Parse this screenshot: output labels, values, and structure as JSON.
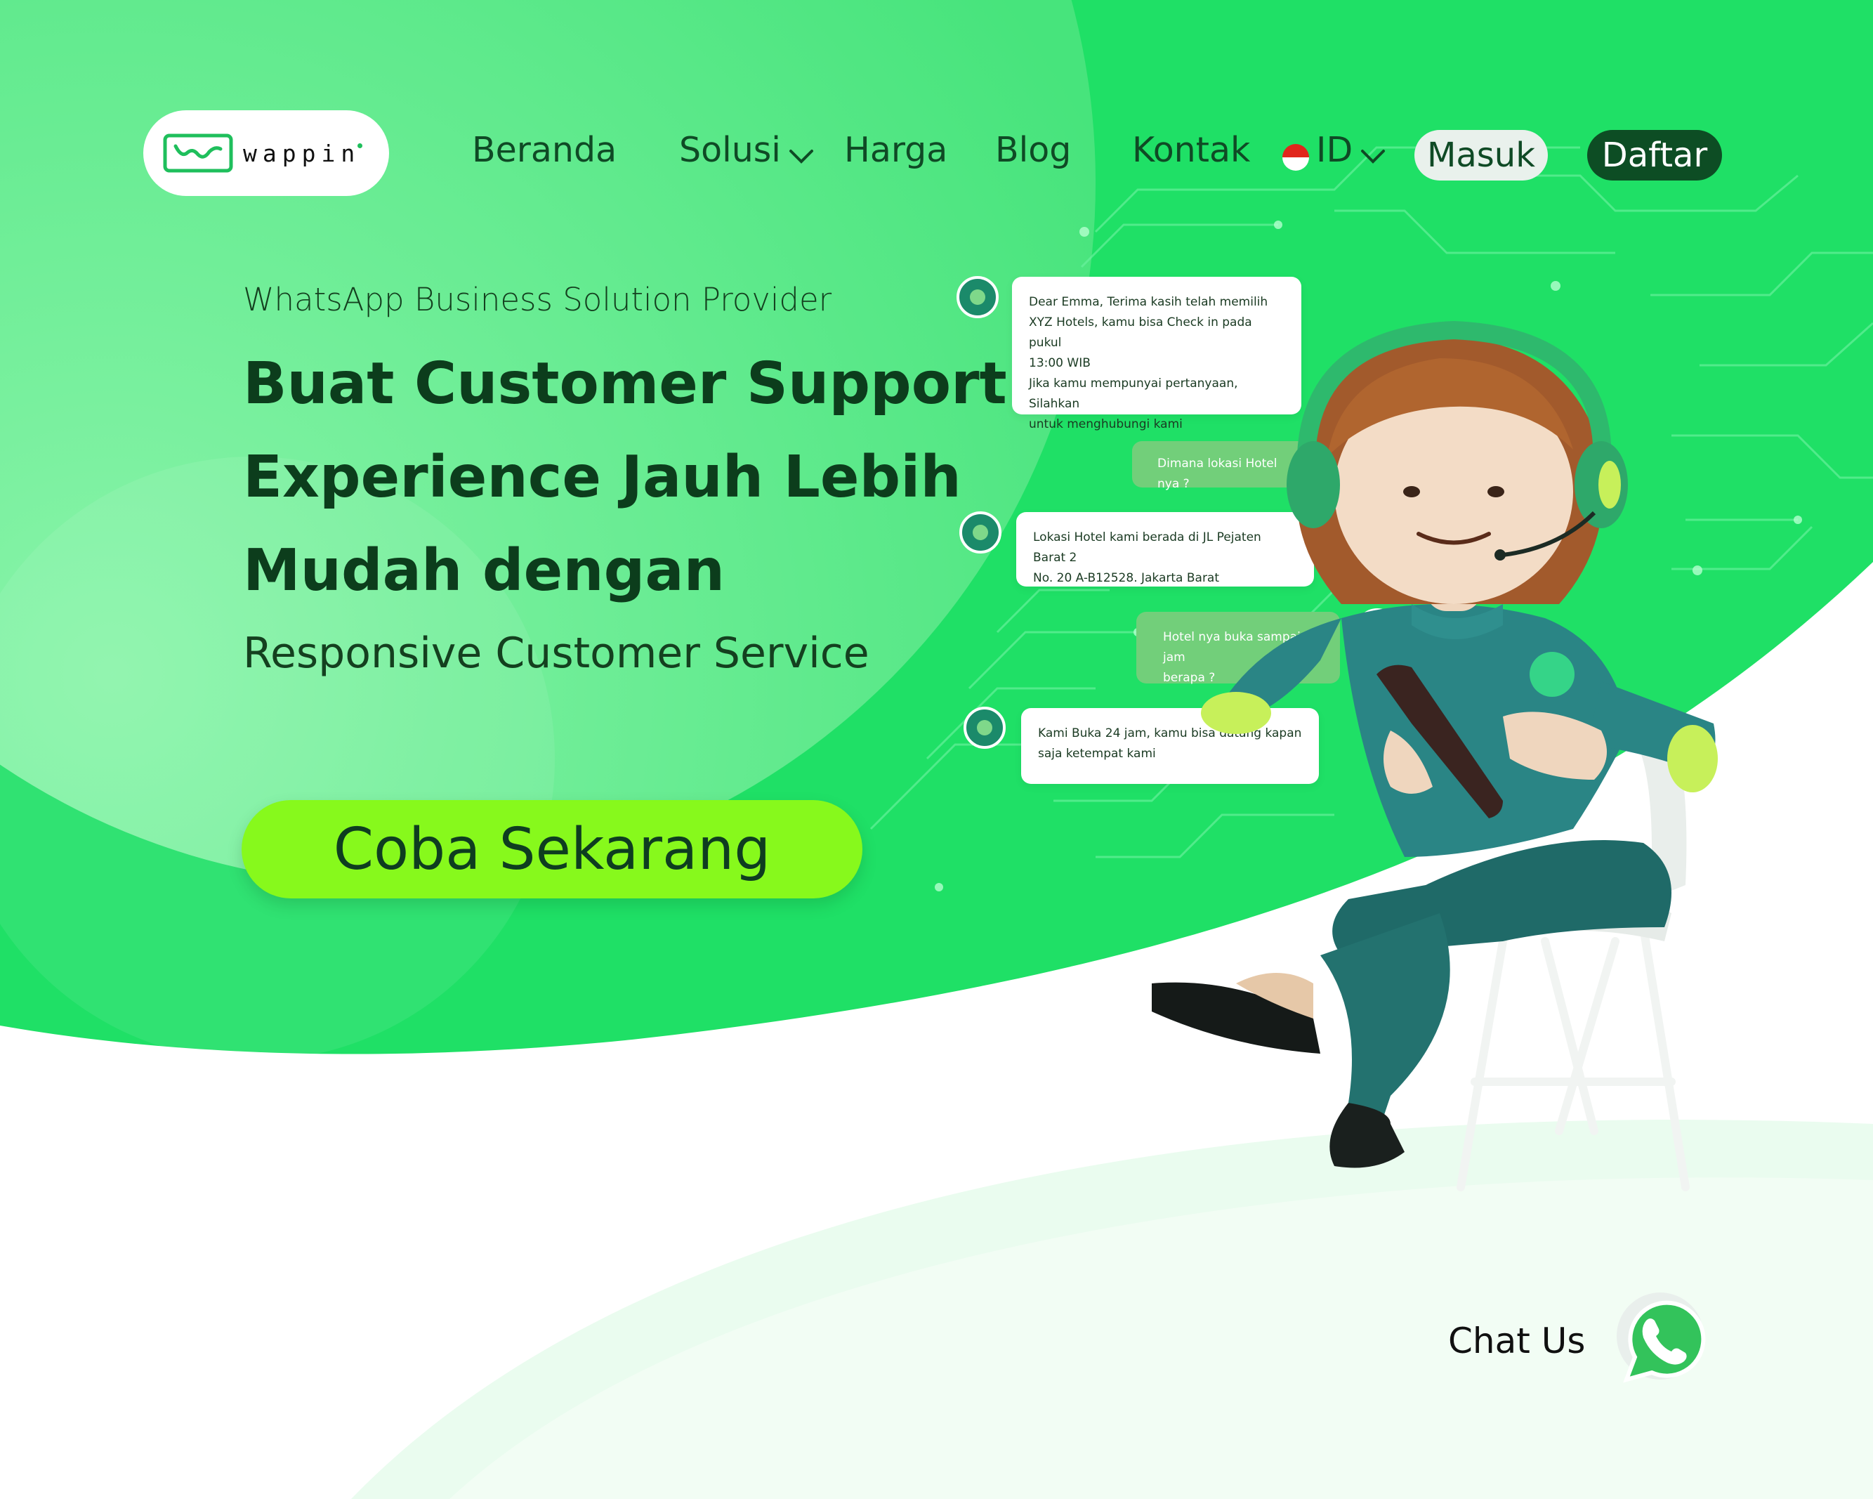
{
  "brand": {
    "name": "wappin",
    "logo_icon": "wappin-logo-icon"
  },
  "nav": {
    "items": [
      {
        "label": "Beranda"
      },
      {
        "label": "Solusi",
        "icon": "chevron-down-icon"
      },
      {
        "label": "Harga"
      },
      {
        "label": "Blog"
      },
      {
        "label": "Kontak"
      }
    ],
    "language": {
      "label": "ID",
      "flag": "indonesia-flag-icon",
      "icon": "chevron-down-icon"
    },
    "login_label": "Masuk",
    "register_label": "Daftar"
  },
  "hero": {
    "eyebrow": "WhatsApp Business Solution Provider",
    "headline_lines": [
      "Buat Customer Support",
      "Experience Jauh Lebih",
      "Mudah dengan"
    ],
    "subline": "Responsive Customer Service",
    "cta_label": "Coba Sekarang"
  },
  "chat": {
    "messages": [
      {
        "from": "bot",
        "lines": [
          "Dear Emma, Terima kasih telah memilih",
          "XYZ Hotels, kamu bisa Check in pada pukul",
          "13:00 WIB",
          "Jika kamu mempunyai pertanyaan, Silahkan",
          "untuk menghubungi kami"
        ]
      },
      {
        "from": "user",
        "lines": [
          "Dimana lokasi Hotel nya ?"
        ]
      },
      {
        "from": "bot",
        "lines": [
          "Lokasi Hotel kami berada di JL Pejaten Barat 2",
          "No. 20 A-B12528. Jakarta Barat"
        ]
      },
      {
        "from": "user",
        "lines": [
          "Hotel nya buka sampai jam",
          "berapa ?"
        ]
      },
      {
        "from": "bot",
        "lines": [
          "Kami Buka 24 jam, kamu bisa datang kapan",
          "saja ketempat kami"
        ]
      }
    ]
  },
  "chat_us": {
    "label": "Chat Us",
    "icon": "whatsapp-icon"
  },
  "colors": {
    "primary_green": "#1fe066",
    "light_green": "#6ff09a",
    "cta_lime": "#87f91c",
    "dark_green": "#0d4d24",
    "bubble_out": "#72cf7a"
  }
}
